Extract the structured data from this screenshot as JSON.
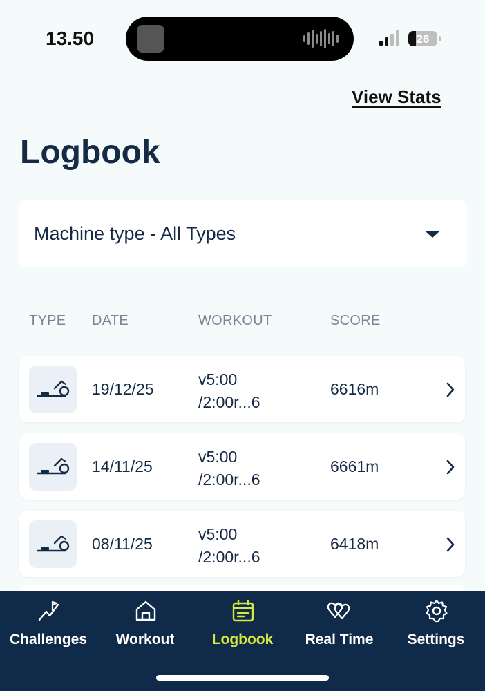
{
  "status_bar": {
    "time": "13.50",
    "battery": "26",
    "battery_level_percent": 26
  },
  "header": {
    "view_stats_label": "View Stats",
    "title": "Logbook"
  },
  "filter": {
    "label": "Machine type -  All Types",
    "selected": "All Types"
  },
  "columns": {
    "type": "TYPE",
    "date": "DATE",
    "workout": "WORKOUT",
    "score": "SCORE"
  },
  "rows": [
    {
      "machine_icon": "rower-icon",
      "date": "19/12/25",
      "workout_line1": "v5:00",
      "workout_line2": "/2:00r...6",
      "score": "6616m"
    },
    {
      "machine_icon": "rower-icon",
      "date": "14/11/25",
      "workout_line1": "v5:00",
      "workout_line2": "/2:00r...6",
      "score": "6661m"
    },
    {
      "machine_icon": "rower-icon",
      "date": "08/11/25",
      "workout_line1": "v5:00",
      "workout_line2": "/2:00r...6",
      "score": "6418m"
    }
  ],
  "tabs": [
    {
      "label": "Challenges",
      "icon": "challenges-icon",
      "active": false
    },
    {
      "label": "Workout",
      "icon": "home-icon",
      "active": false
    },
    {
      "label": "Logbook",
      "icon": "logbook-icon",
      "active": true
    },
    {
      "label": "Real Time",
      "icon": "hearts-icon",
      "active": false
    },
    {
      "label": "Settings",
      "icon": "gear-icon",
      "active": false
    }
  ],
  "colors": {
    "background": "#f5fbfb",
    "navy": "#142a45",
    "tabbar": "#102a49",
    "active_tab": "#d6ea3d",
    "muted": "#7a8697"
  }
}
